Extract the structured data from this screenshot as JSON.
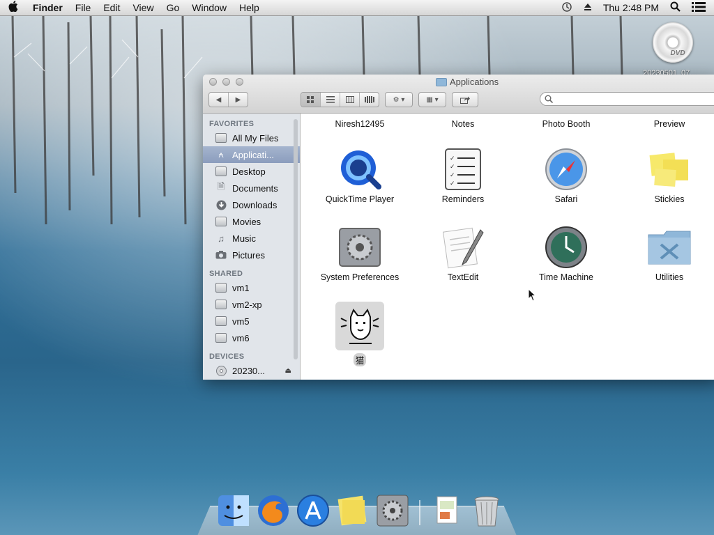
{
  "menubar": {
    "app_name": "Finder",
    "menus": [
      "File",
      "Edit",
      "View",
      "Go",
      "Window",
      "Help"
    ],
    "clock": "Thu 2:48 PM"
  },
  "desktop": {
    "dvd_badge": "DVD",
    "dvd_label": "20230501_07..."
  },
  "window": {
    "title": "Applications",
    "search_placeholder": ""
  },
  "sidebar": {
    "favorites_header": "FAVORITES",
    "favorites": [
      "All My Files",
      "Applicati...",
      "Desktop",
      "Documents",
      "Downloads",
      "Movies",
      "Music",
      "Pictures"
    ],
    "shared_header": "SHARED",
    "shared": [
      "vm1",
      "vm2-xp",
      "vm5",
      "vm6"
    ],
    "devices_header": "DEVICES",
    "devices": [
      "20230..."
    ]
  },
  "content": {
    "top_row_labels": [
      "Niresh12495",
      "Notes",
      "Photo Booth",
      "Preview"
    ],
    "apps": [
      "QuickTime Player",
      "Reminders",
      "Safari",
      "Stickies",
      "System Preferences",
      "TextEdit",
      "Time Machine",
      "Utilities",
      "猫"
    ]
  },
  "colors": {
    "sidebar_bg": "#e1e5ea",
    "sidebar_selection": "#8b9dbd",
    "folder_blue": "#8fb7d9"
  }
}
